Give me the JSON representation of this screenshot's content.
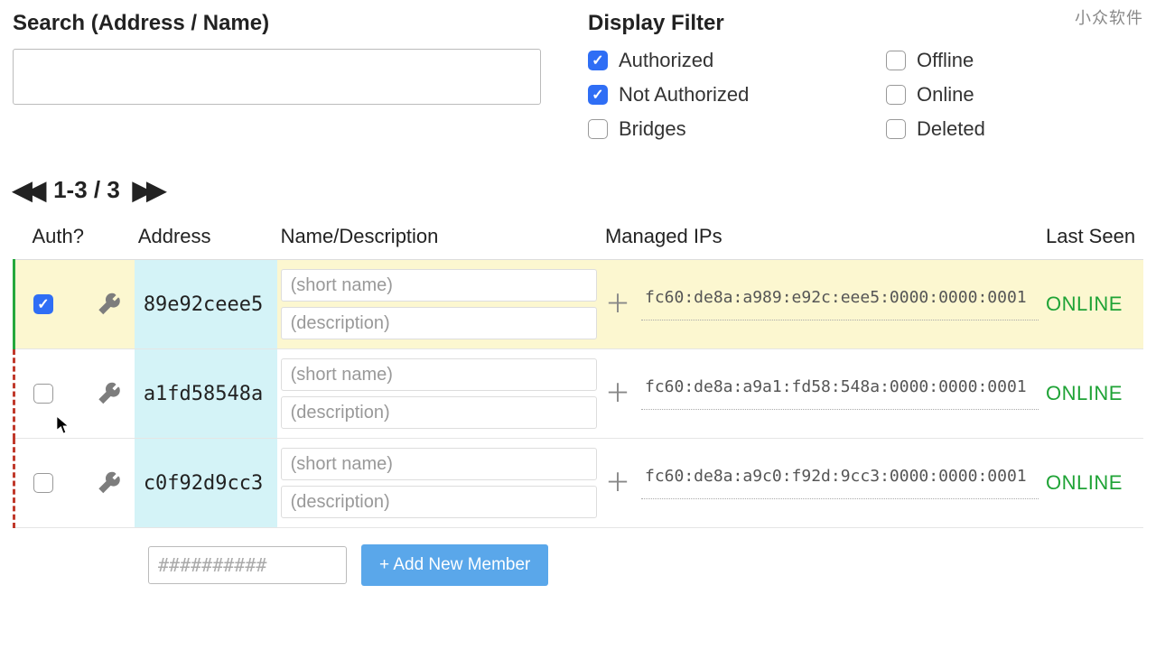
{
  "watermark": "小众软件",
  "search": {
    "label": "Search (Address / Name)",
    "value": ""
  },
  "filter": {
    "label": "Display Filter",
    "options": {
      "authorized": {
        "label": "Authorized",
        "checked": true
      },
      "notAuthorized": {
        "label": "Not Authorized",
        "checked": true
      },
      "bridges": {
        "label": "Bridges",
        "checked": false
      },
      "offline": {
        "label": "Offline",
        "checked": false
      },
      "online": {
        "label": "Online",
        "checked": false
      },
      "deleted": {
        "label": "Deleted",
        "checked": false
      }
    }
  },
  "pagination": {
    "range": "1-3 / 3"
  },
  "table": {
    "columns": {
      "auth": "Auth?",
      "address": "Address",
      "name": "Name/Description",
      "ips": "Managed IPs",
      "seen": "Last Seen"
    },
    "placeholders": {
      "shortName": "(short name)",
      "description": "(description)"
    },
    "rows": [
      {
        "auth": true,
        "address": "89e92ceee5",
        "shortName": "",
        "description": "",
        "ip": "fc60:de8a:a989:e92c:eee5:0000:0000:0001",
        "status": "ONLINE"
      },
      {
        "auth": false,
        "address": "a1fd58548a",
        "shortName": "",
        "description": "",
        "ip": "fc60:de8a:a9a1:fd58:548a:0000:0000:0001",
        "status": "ONLINE"
      },
      {
        "auth": false,
        "address": "c0f92d9cc3",
        "shortName": "",
        "description": "",
        "ip": "fc60:de8a:a9c0:f92d:9cc3:0000:0000:0001",
        "status": "ONLINE"
      }
    ]
  },
  "addMember": {
    "placeholder": "##########",
    "button": "+ Add New Member"
  }
}
